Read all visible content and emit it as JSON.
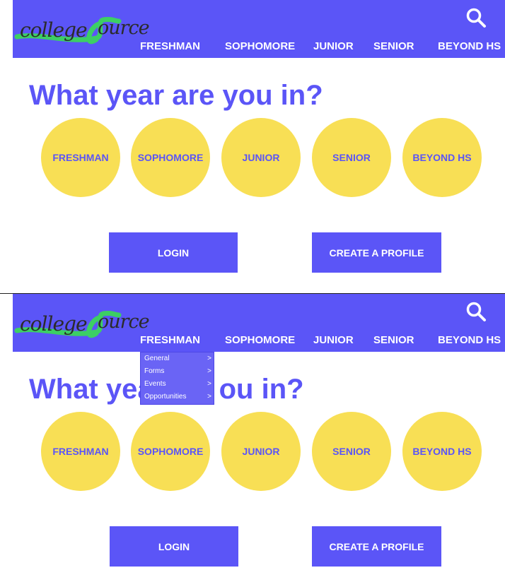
{
  "brand": {
    "logo_part1": "college",
    "logo_part2": "ource"
  },
  "nav": {
    "items": [
      "FRESHMAN",
      "SOPHOMORE",
      "JUNIOR",
      "SENIOR",
      "BEYOND HS"
    ],
    "search_icon": "search-icon"
  },
  "main": {
    "headline": "What year are you in?",
    "headline_part1": "What yea",
    "headline_part2": "ou in?",
    "years": [
      "FRESHMAN",
      "SOPHOMORE",
      "JUNIOR",
      "SENIOR",
      "BEYOND HS"
    ],
    "login_label": "LOGIN",
    "create_profile_label": "CREATE A PROFILE"
  },
  "dropdown": {
    "items": [
      {
        "label": "General",
        "chevron": ">"
      },
      {
        "label": "Forms",
        "chevron": ">"
      },
      {
        "label": "Events",
        "chevron": ">"
      },
      {
        "label": "Opportunities",
        "chevron": ">"
      }
    ]
  },
  "colors": {
    "accent": "#5b55f7",
    "circle": "#f8df55",
    "logo_swoosh": "#3ccf64"
  }
}
